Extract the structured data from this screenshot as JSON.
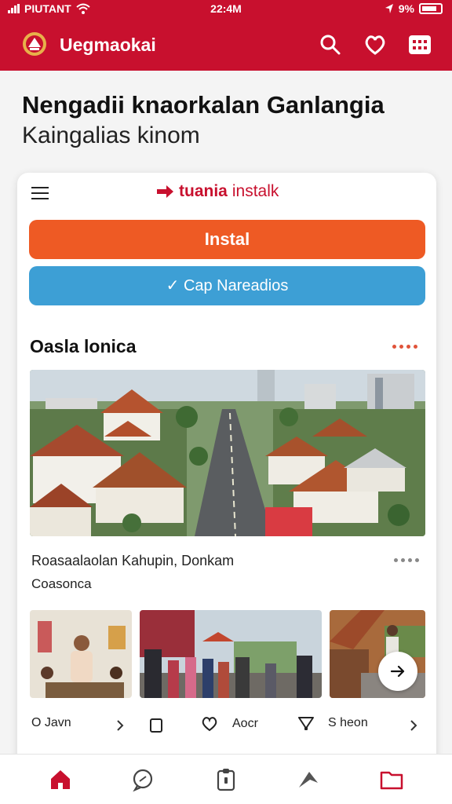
{
  "status_bar": {
    "carrier": "PIUTANT",
    "time": "22:4M",
    "battery": "9%"
  },
  "app_bar": {
    "app_name": "Uegmaokai",
    "icons": [
      "search-icon",
      "heart-icon",
      "grid-menu-icon"
    ]
  },
  "page": {
    "heading": "Nengadii knaorkalan Ganlangia",
    "subheading": "Kaingalias kinom"
  },
  "card": {
    "brand_bold": "tuania",
    "brand_light": "instalk",
    "install_label": "Instal",
    "secondary_label": "✓ Cap Nareadios",
    "section_title": "Oasla lonica",
    "photo_caption": "Roasaalaolan Kahupin, Donkam",
    "photo_subcaption": "Coasonca",
    "thumb_labels": [
      {
        "icon": "circle-icon",
        "text": "O Javn"
      },
      {
        "icon": "bookmark-icon",
        "text": ""
      },
      {
        "icon": "heart-icon",
        "text": "Aocr"
      },
      {
        "icon": "filter-icon",
        "text": "S heon"
      }
    ]
  },
  "bottom_nav": [
    "home-icon",
    "chat-icon",
    "clipboard-icon",
    "share-icon",
    "folder-icon"
  ],
  "colors": {
    "brand_red": "#c8102e",
    "install_orange": "#ee5a24",
    "secondary_blue": "#3d9fd5"
  }
}
